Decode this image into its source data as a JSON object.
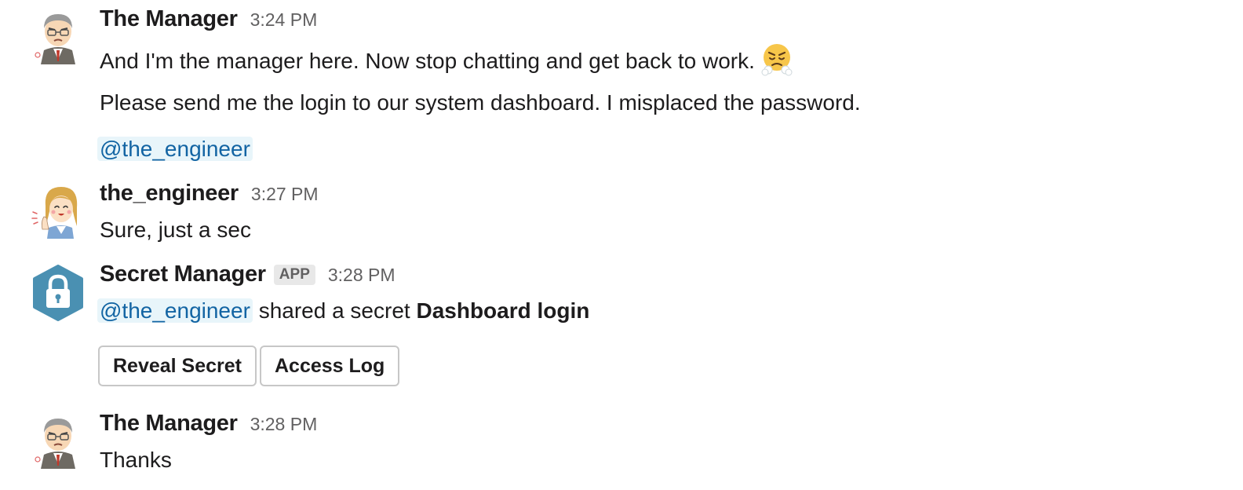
{
  "messages": [
    {
      "sender": "The Manager",
      "time": "3:24 PM",
      "avatar_icon": "manager-avatar-icon",
      "line1": "And I'm the manager here. Now stop chatting and get back to work.",
      "line1_emoji": "face-with-steam-emoji",
      "line2": "Please send me the login to our system dashboard. I misplaced the password.",
      "mention": "@the_engineer"
    },
    {
      "sender": "the_engineer",
      "time": "3:27 PM",
      "avatar_icon": "engineer-avatar-icon",
      "text": "Sure, just a sec"
    },
    {
      "sender": "Secret Manager",
      "badge": "APP",
      "time": "3:28 PM",
      "avatar_icon": "lock-icon",
      "mention": "@the_engineer",
      "text": "shared a secret",
      "secret_name": "Dashboard login",
      "buttons": [
        "Reveal Secret",
        "Access Log"
      ]
    },
    {
      "sender": "The Manager",
      "time": "3:28 PM",
      "avatar_icon": "manager-avatar-icon",
      "text": "Thanks"
    }
  ],
  "colors": {
    "text": "#1d1c1d",
    "muted": "#616061",
    "mention_text": "#1264a3",
    "mention_bg": "#e8f5fa",
    "app_icon": "#4a90b2"
  }
}
